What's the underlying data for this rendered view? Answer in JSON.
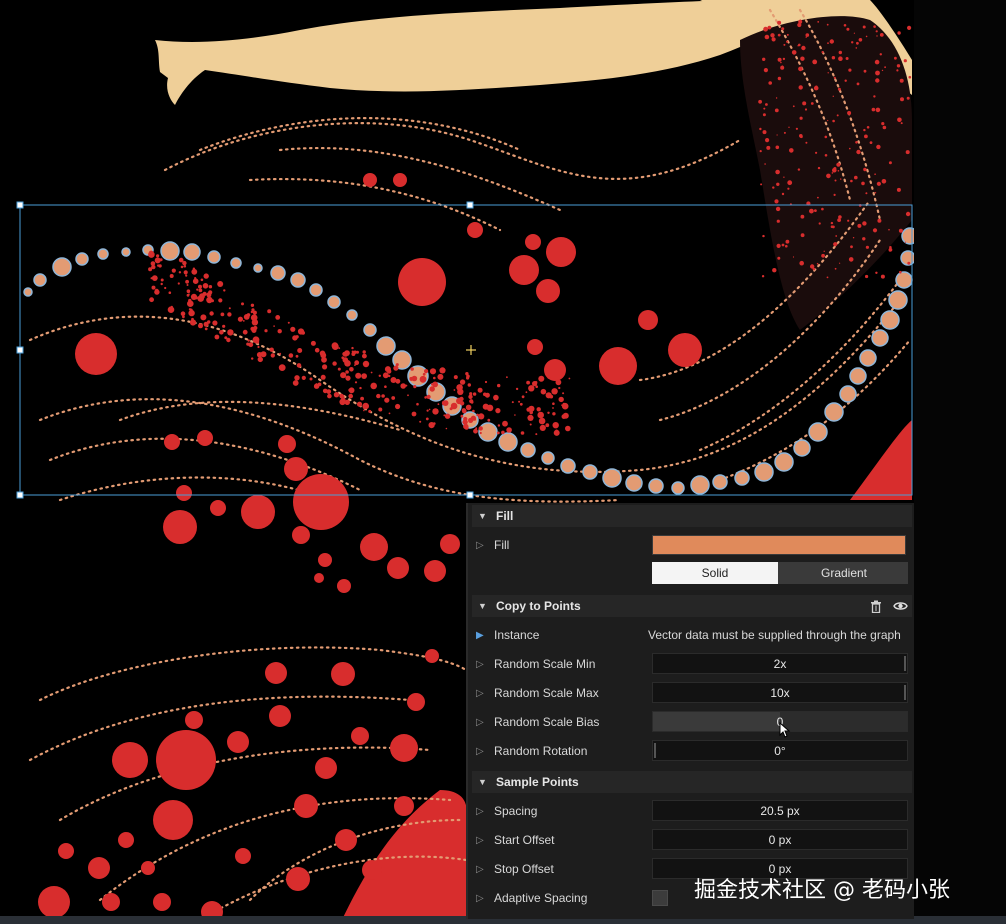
{
  "colors": {
    "fill_swatch": "#e08a5b",
    "bead": "#e39b73",
    "bead_ring": "#8fb6d8",
    "red_dot": "#d82d2d",
    "skin": "#efcf98",
    "selection": "#4a9ed8"
  },
  "panel": {
    "fill_section": {
      "title": "Fill",
      "fill_label": "Fill",
      "fill_color": "#e08a5b",
      "tabs": [
        "Solid",
        "Gradient"
      ],
      "active_tab": "Solid"
    },
    "copy_to_points": {
      "title": "Copy to Points",
      "delete_icon": "trash-icon",
      "visibility_icon": "eye-icon",
      "instance_label": "Instance",
      "instance_value": "Vector data must be supplied through the graph",
      "rows": [
        {
          "label": "Random Scale Min",
          "value": "2x"
        },
        {
          "label": "Random Scale Max",
          "value": "10x"
        },
        {
          "label": "Random Scale Bias",
          "value": "0"
        },
        {
          "label": "Random Rotation",
          "value": "0°"
        }
      ]
    },
    "sample_points": {
      "title": "Sample Points",
      "rows": [
        {
          "label": "Spacing",
          "value": "20.5 px"
        },
        {
          "label": "Start Offset",
          "value": "0 px"
        },
        {
          "label": "Stop Offset",
          "value": "0 px"
        }
      ],
      "adaptive_label": "Adaptive Spacing",
      "adaptive_checked": false
    }
  },
  "watermark": "掘金技术社区 @ 老码小张"
}
